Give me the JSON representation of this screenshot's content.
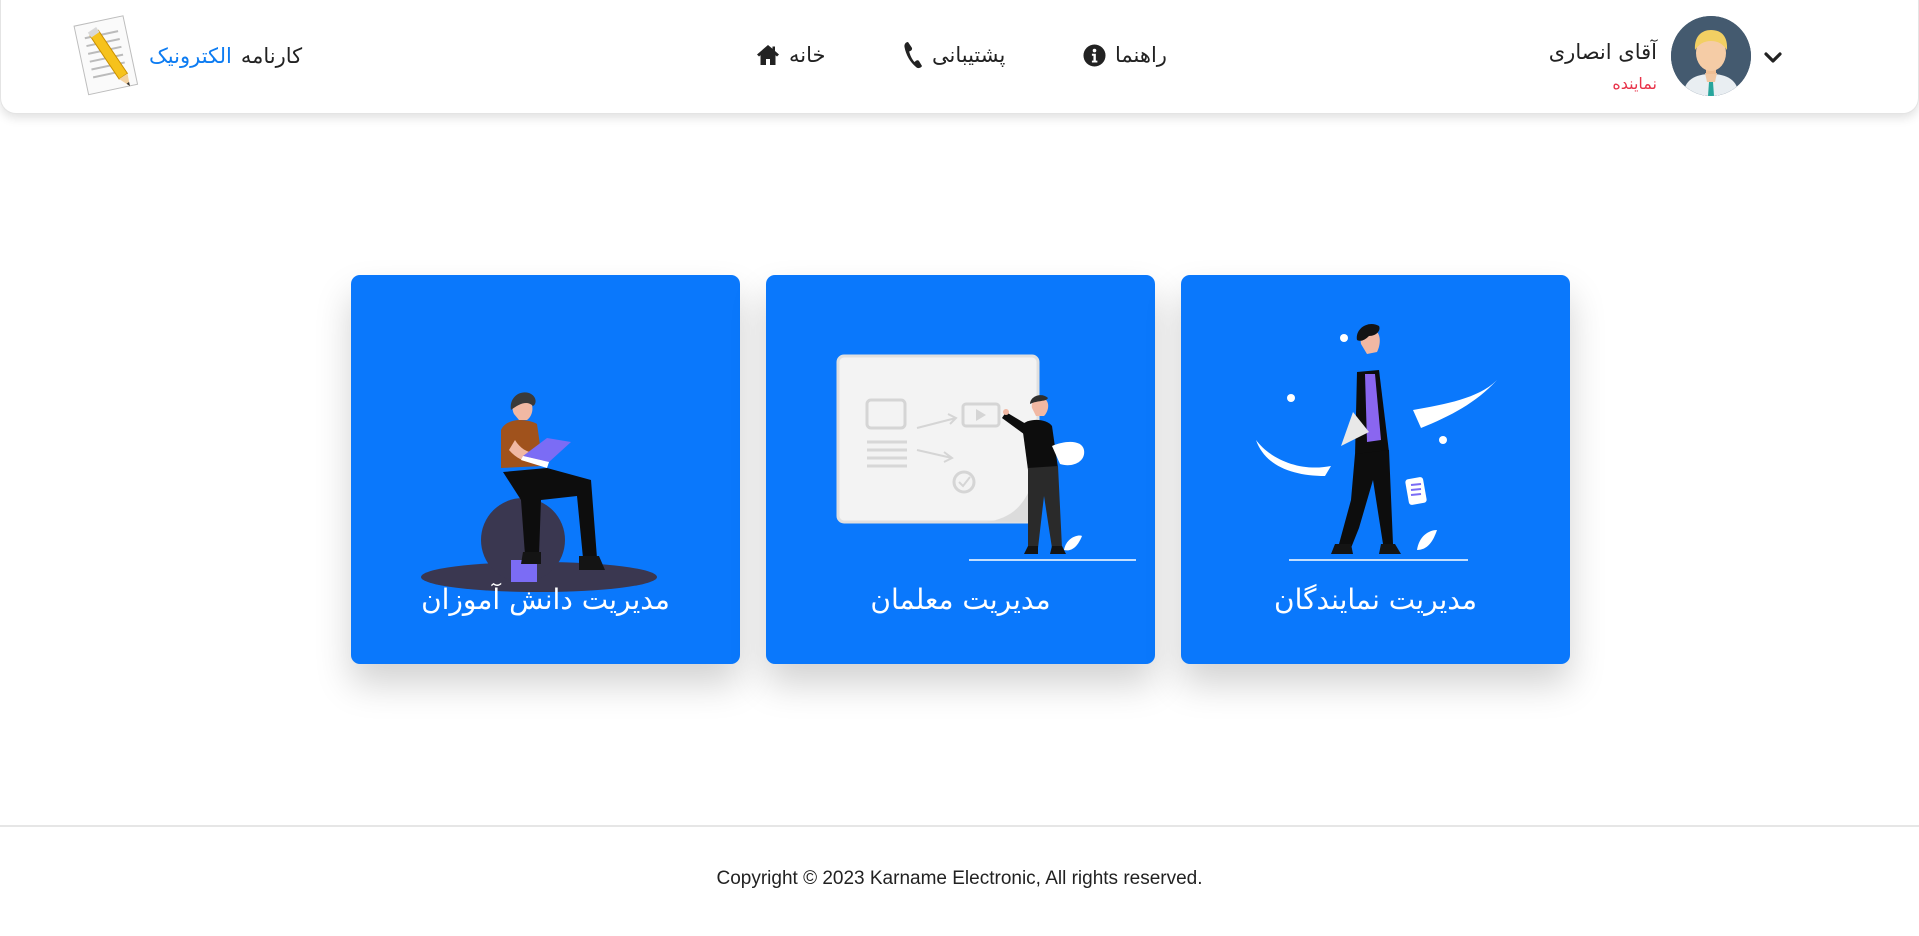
{
  "brand": {
    "word": "کارنامه",
    "accent": "الکترونیک",
    "accent_color": "#0d7cf2",
    "logo_icon": "pencil-paper-icon"
  },
  "nav": {
    "home": {
      "label": "خانه",
      "icon": "home-icon"
    },
    "support": {
      "label": "پشتیبانی",
      "icon": "phone-icon"
    },
    "guide": {
      "label": "راهنما",
      "icon": "info-icon"
    }
  },
  "user": {
    "name": "آقای انصاری",
    "role": "نماینده",
    "role_color": "#e8334a",
    "menu_icon": "chevron-down-icon"
  },
  "cards": [
    {
      "title": "مدیریت دانش آموزان",
      "icon": "reading-student-illustration"
    },
    {
      "title": "مدیریت معلمان",
      "icon": "teacher-board-illustration"
    },
    {
      "title": "مدیریت نمایندگان",
      "icon": "walking-representative-illustration"
    }
  ],
  "colors": {
    "card_bg": "#0a78fc"
  },
  "footer": {
    "copyright": "Copyright © 2023 Karname Electronic, All rights reserved."
  }
}
